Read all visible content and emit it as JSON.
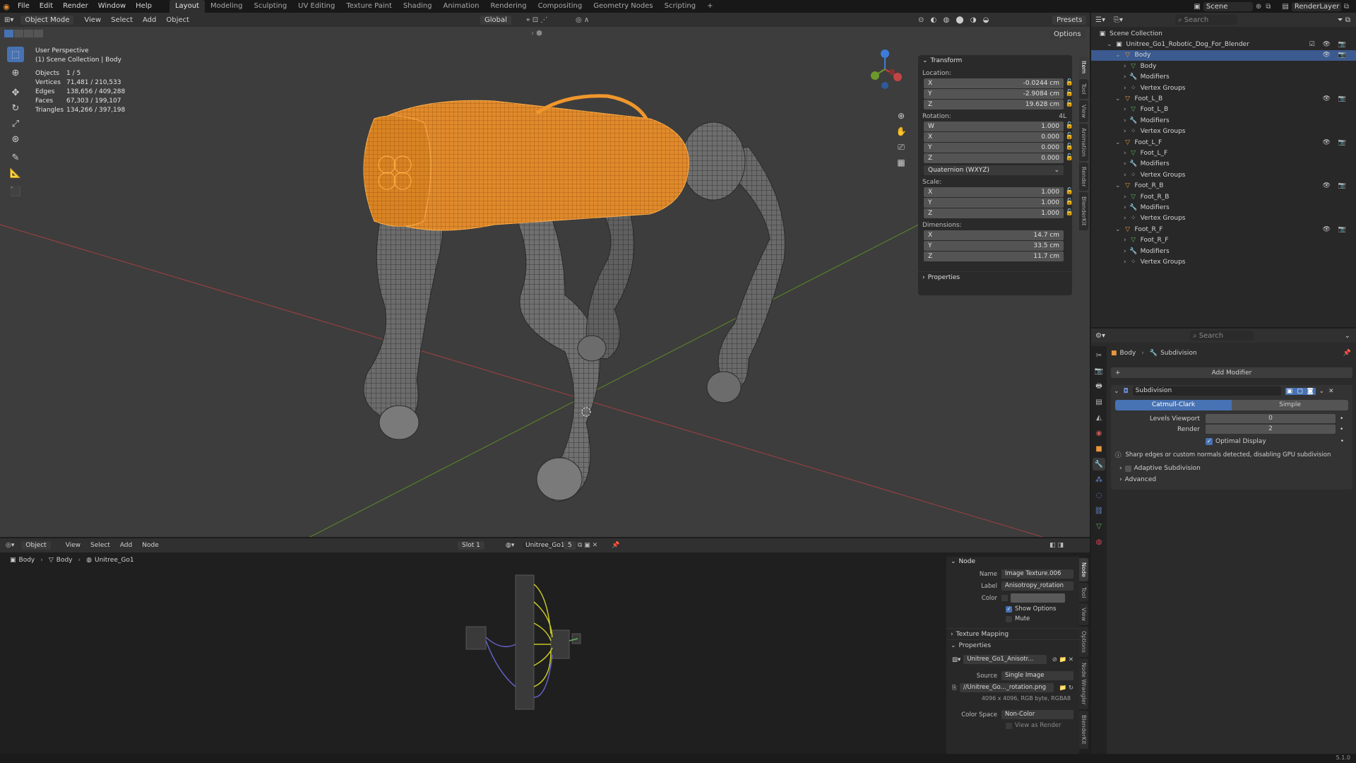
{
  "menu": {
    "file": "File",
    "edit": "Edit",
    "render": "Render",
    "window": "Window",
    "help": "Help"
  },
  "workspaces": [
    "Layout",
    "Modeling",
    "Sculpting",
    "UV Editing",
    "Texture Paint",
    "Shading",
    "Animation",
    "Rendering",
    "Compositing",
    "Geometry Nodes",
    "Scripting"
  ],
  "workspace_add": "+",
  "scene_name": "Scene",
  "render_layer": "RenderLayer",
  "viewport": {
    "mode": "Object Mode",
    "menus": [
      "View",
      "Select",
      "Add",
      "Object"
    ],
    "transform_orientation": "Global",
    "options": "Options",
    "presets": "Presets",
    "overlay_title": "User Perspective",
    "overlay_collection": "(1) Scene Collection | Body",
    "stats": [
      {
        "label": "Objects",
        "value": "1 / 5"
      },
      {
        "label": "Vertices",
        "value": "71,481 / 210,533"
      },
      {
        "label": "Edges",
        "value": "138,656 / 409,288"
      },
      {
        "label": "Faces",
        "value": "67,303 / 199,107"
      },
      {
        "label": "Triangles",
        "value": "134,266 / 397,198"
      }
    ]
  },
  "npanel": {
    "transform": "Transform",
    "location": "Location:",
    "loc": [
      {
        "axis": "X",
        "value": "-0.0244 cm"
      },
      {
        "axis": "Y",
        "value": "-2.9084 cm"
      },
      {
        "axis": "Z",
        "value": "19.628 cm"
      }
    ],
    "rotation": "Rotation:",
    "rot_mode_short": "4L",
    "rot": [
      {
        "axis": "W",
        "value": "1.000"
      },
      {
        "axis": "X",
        "value": "0.000"
      },
      {
        "axis": "Y",
        "value": "0.000"
      },
      {
        "axis": "Z",
        "value": "0.000"
      }
    ],
    "rot_mode": "Quaternion (WXYZ)",
    "scale": "Scale:",
    "scl": [
      {
        "axis": "X",
        "value": "1.000"
      },
      {
        "axis": "Y",
        "value": "1.000"
      },
      {
        "axis": "Z",
        "value": "1.000"
      }
    ],
    "dimensions": "Dimensions:",
    "dim": [
      {
        "axis": "X",
        "value": "14.7 cm"
      },
      {
        "axis": "Y",
        "value": "33.5 cm"
      },
      {
        "axis": "Z",
        "value": "11.7 cm"
      }
    ],
    "properties": "Properties",
    "tabs": [
      "Item",
      "Tool",
      "View",
      "Animation",
      "Render",
      "BlenderKit"
    ]
  },
  "outliner": {
    "search": "Search",
    "scene_collection": "Scene Collection",
    "rows": [
      {
        "label": "Unitree_Go1_Robotic_Dog_For_Blender",
        "indent": 1,
        "icon": "collection-icon",
        "sel": false
      },
      {
        "label": "Body",
        "indent": 2,
        "icon": "object-icon",
        "sel": true
      },
      {
        "label": "Body",
        "indent": 3,
        "icon": "mesh-icon",
        "sel": false
      },
      {
        "label": "Modifiers",
        "indent": 3,
        "icon": "wrench-icon",
        "sel": false
      },
      {
        "label": "Vertex Groups",
        "indent": 3,
        "icon": "vertex-groups-icon",
        "sel": false
      },
      {
        "label": "Foot_L_B",
        "indent": 2,
        "icon": "object-icon",
        "sel": false
      },
      {
        "label": "Foot_L_B",
        "indent": 3,
        "icon": "mesh-icon",
        "sel": false
      },
      {
        "label": "Modifiers",
        "indent": 3,
        "icon": "wrench-icon",
        "sel": false
      },
      {
        "label": "Vertex Groups",
        "indent": 3,
        "icon": "vertex-groups-icon",
        "sel": false
      },
      {
        "label": "Foot_L_F",
        "indent": 2,
        "icon": "object-icon",
        "sel": false
      },
      {
        "label": "Foot_L_F",
        "indent": 3,
        "icon": "mesh-icon",
        "sel": false
      },
      {
        "label": "Modifiers",
        "indent": 3,
        "icon": "wrench-icon",
        "sel": false
      },
      {
        "label": "Vertex Groups",
        "indent": 3,
        "icon": "vertex-groups-icon",
        "sel": false
      },
      {
        "label": "Foot_R_B",
        "indent": 2,
        "icon": "object-icon",
        "sel": false
      },
      {
        "label": "Foot_R_B",
        "indent": 3,
        "icon": "mesh-icon",
        "sel": false
      },
      {
        "label": "Modifiers",
        "indent": 3,
        "icon": "wrench-icon",
        "sel": false
      },
      {
        "label": "Vertex Groups",
        "indent": 3,
        "icon": "vertex-groups-icon",
        "sel": false
      },
      {
        "label": "Foot_R_F",
        "indent": 2,
        "icon": "object-icon",
        "sel": false
      },
      {
        "label": "Foot_R_F",
        "indent": 3,
        "icon": "mesh-icon",
        "sel": false
      },
      {
        "label": "Modifiers",
        "indent": 3,
        "icon": "wrench-icon",
        "sel": false
      },
      {
        "label": "Vertex Groups",
        "indent": 3,
        "icon": "vertex-groups-icon",
        "sel": false
      }
    ]
  },
  "properties": {
    "search": "Search",
    "crumb_object": "Body",
    "crumb_modifier": "Subdivision",
    "add_modifier": "Add Modifier",
    "modifier_name": "Subdivision",
    "catmull": "Catmull-Clark",
    "simple": "Simple",
    "levels_label": "Levels Viewport",
    "levels_value": "0",
    "render_label": "Render",
    "render_value": "2",
    "optimal": "Optimal Display",
    "warning": "Sharp edges or custom normals detected, disabling GPU subdivision",
    "adaptive": "Adaptive Subdivision",
    "advanced": "Advanced"
  },
  "node_editor": {
    "object": "Object",
    "menus": [
      "View",
      "Select",
      "Add",
      "Node"
    ],
    "slot": "Slot 1",
    "material": "Unitree_Go1",
    "users": "5",
    "crumbs": [
      "Body",
      "Body",
      "Unitree_Go1"
    ],
    "node_header": "Node",
    "name_label": "Name",
    "name_value": "Image Texture.006",
    "label_label": "Label",
    "label_value": "Anisotropy_rotation",
    "color_label": "Color",
    "show_options": "Show Options",
    "mute": "Mute",
    "texture_mapping": "Texture Mapping",
    "properties": "Properties",
    "image_name": "Unitree_Go1_Anisotr...",
    "source_label": "Source",
    "source_value": "Single Image",
    "filepath": "//Unitree_Go..._rotation.png",
    "image_info": "4096 x 4096, RGB byte, RGBA8",
    "colorspace_label": "Color Space",
    "colorspace_value": "Non-Color",
    "view_as_render": "View as Render",
    "tabs": [
      "Node",
      "Tool",
      "View",
      "Options",
      "Node Wrangler",
      "BlenderKit"
    ]
  },
  "version": "5.1.0",
  "colors": {
    "accent": "#4772b3",
    "selection_orange": "#f0962c",
    "axis_x": "#c24444",
    "axis_y": "#6b9a2a",
    "axis_z": "#3d7bd9"
  }
}
